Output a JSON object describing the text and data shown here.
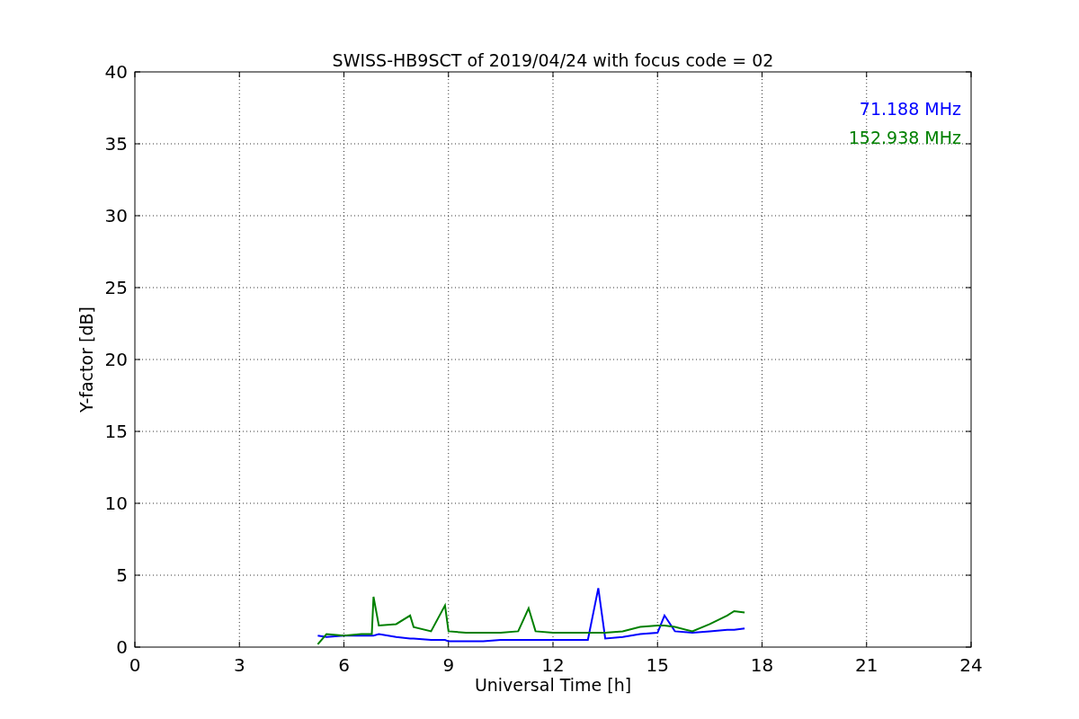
{
  "figure": {
    "chart_data": {
      "type": "line",
      "title": "SWISS-HB9SCT of 2019/04/24 with focus code = 02",
      "xlabel": "Universal Time [h]",
      "ylabel": "Y-factor [dB]",
      "x": [
        5.25,
        5.5,
        6,
        6.5,
        6.8,
        6.85,
        7,
        7.5,
        7.9,
        8,
        8.5,
        8.9,
        9,
        9.5,
        10,
        10.5,
        11,
        11.3,
        11.5,
        12,
        12.5,
        13,
        13.3,
        13.5,
        14,
        14.5,
        15,
        15.2,
        15.5,
        16,
        16.5,
        17,
        17.2,
        17.5
      ],
      "series": [
        {
          "name": "71.188 MHz",
          "color": "#0000ff",
          "values": [
            0.8,
            0.7,
            0.8,
            0.8,
            0.8,
            0.8,
            0.9,
            0.7,
            0.6,
            0.6,
            0.5,
            0.5,
            0.4,
            0.4,
            0.4,
            0.5,
            0.5,
            0.5,
            0.5,
            0.5,
            0.5,
            0.5,
            4.1,
            0.6,
            0.7,
            0.9,
            1.0,
            2.2,
            1.1,
            1.0,
            1.1,
            1.2,
            1.2,
            1.3
          ]
        },
        {
          "name": "152.938 MHz",
          "color": "#008000",
          "values": [
            0.2,
            0.9,
            0.8,
            0.9,
            0.9,
            3.5,
            1.5,
            1.6,
            2.2,
            1.4,
            1.1,
            2.9,
            1.1,
            1.0,
            1.0,
            1.0,
            1.1,
            2.7,
            1.1,
            1.0,
            1.0,
            1.0,
            1.0,
            1.0,
            1.1,
            1.4,
            1.5,
            1.5,
            1.4,
            1.1,
            1.6,
            2.2,
            2.5,
            2.4
          ]
        }
      ],
      "grid": true,
      "xlim": [
        0,
        24
      ],
      "ylim": [
        0,
        40
      ],
      "xticks": [
        0,
        3,
        6,
        9,
        12,
        15,
        18,
        21,
        24
      ],
      "yticks": [
        0,
        5,
        10,
        15,
        20,
        25,
        30,
        35,
        40
      ]
    }
  }
}
